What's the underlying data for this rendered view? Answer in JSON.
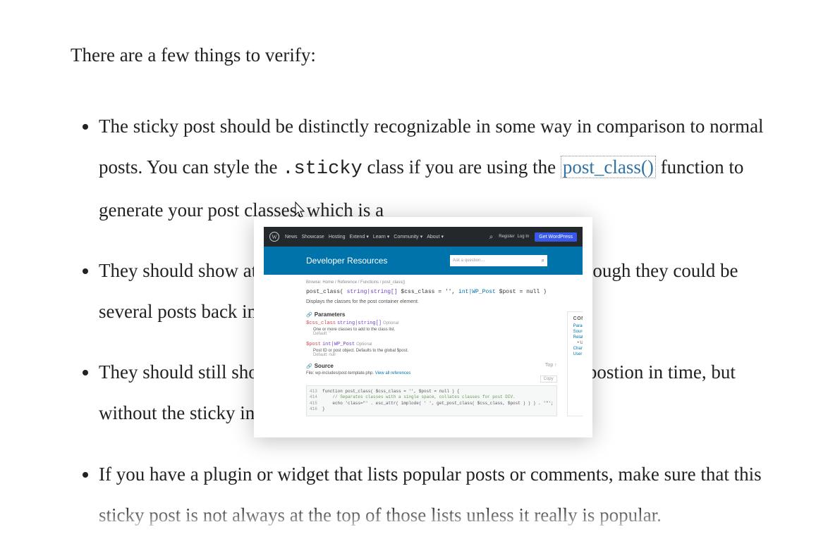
{
  "intro": "There are a few things to verify:",
  "li1_a": "The sticky post should be distinctly recognizable in some way in comparison to normal posts. You can style the ",
  "li1_code": ".sticky",
  "li1_b": " class if you are using the ",
  "li1_link": "post_class()",
  "li1_c": " function to generate your post classes, which is a ",
  "li2": "They should show at the very top of the blog index page, even though they could be several posts back in time.",
  "li3": "They should still show up again in their chronologically correct postion in time, but without the sticky indicator.",
  "li4": "If you have a plugin or widget that lists popular posts or comments, make sure that this sticky post is not always at the top of those lists unless it really is popular.",
  "popup": {
    "menu": [
      "News",
      "Showcase",
      "Hosting",
      "Extend",
      "Learn",
      "Community",
      "About"
    ],
    "menu_chev": [
      false,
      false,
      false,
      true,
      true,
      true,
      true
    ],
    "reg": "Register",
    "login": "Log In",
    "cta": "Get WordPress",
    "hero_title": "Developer Resources",
    "hero_search_ph": "Ask a question…",
    "breadcrumb": "Browse: Home / Reference / Functions / post_class()",
    "sig_name": "post_class( ",
    "sig_t1": "string|string[]",
    "sig_p1": " $css_class",
    "sig_eq1": " = '', ",
    "sig_t2": "int|WP_Post",
    "sig_p2": " $post",
    "sig_eq2": " = null )",
    "desc": "Displays the classes for the post container element.",
    "contents_h": "CONTENTS",
    "toc": [
      "Parameters",
      "Source",
      "Related",
      "Uses",
      "Changelog",
      "User Contributed Notes"
    ],
    "params_h": "Parameters",
    "param1_name": "$css_class",
    "param1_type": "string|string[]",
    "param1_opt": "Optional",
    "param1_desc": "One or more classes to add to the class list.",
    "param1_def": "Default: ''",
    "param2_name": "$post",
    "param2_type": "int|WP_Post",
    "param2_opt": "Optional",
    "param2_desc": "Post ID or post object. Defaults to the global $post.",
    "param2_def": "Default: null",
    "source_h": "Source",
    "source_top": "Top ↑",
    "file_pre": "File: ",
    "file_path": "wp-includes/post-template.php",
    "file_link": "View all references",
    "copy": "Copy",
    "code_lines": [
      {
        "n": "413",
        "t": "function post_class( $css_class = '', $post = null ) {"
      },
      {
        "n": "414",
        "t": "    // Separates classes with a single space, collates classes for post DIV."
      },
      {
        "n": "415",
        "t": "    echo 'class=\"' . esc_attr( implode( ' ', get_post_class( $css_class, $post ) ) ) . '\"';"
      },
      {
        "n": "416",
        "t": "}"
      }
    ]
  }
}
